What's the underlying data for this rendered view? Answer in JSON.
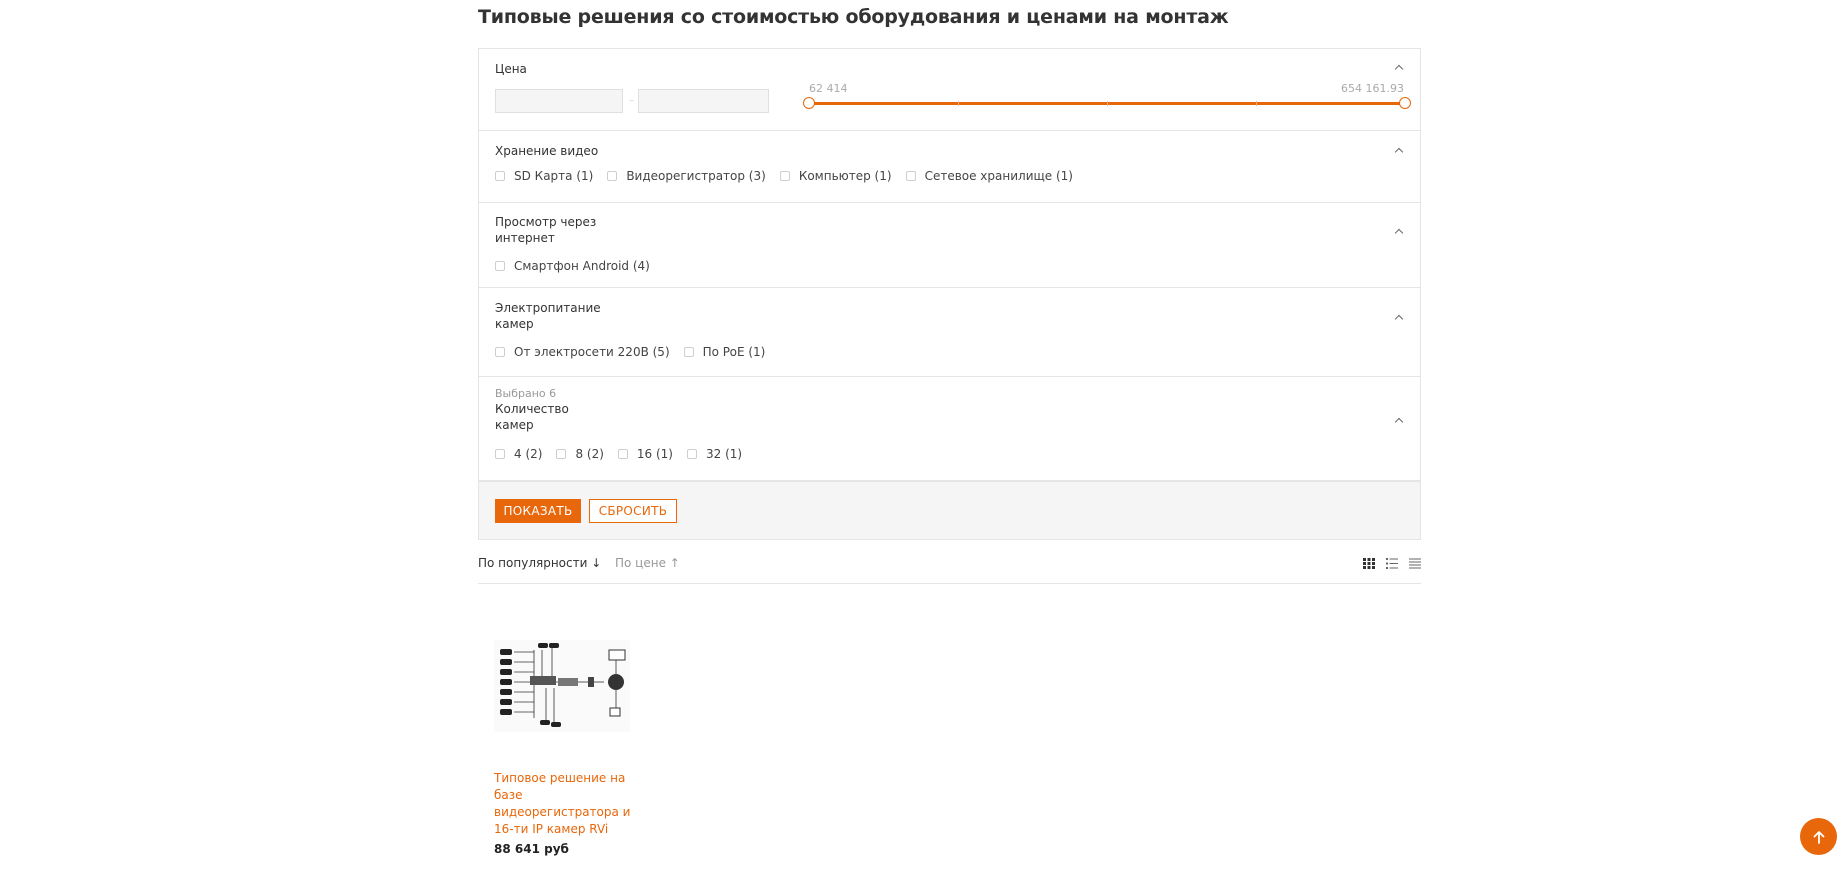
{
  "page": {
    "title": "Типовые решения со стоимостью оборудования и ценами на монтаж"
  },
  "filters": {
    "price": {
      "title": "Цена",
      "min_value": "",
      "max_value": "",
      "range_dash": "–",
      "slider_min_label": "62 414",
      "slider_max_label": "654 161.93",
      "selected_min_fraction": 0,
      "selected_max_fraction": 1
    },
    "storage": {
      "title": "Хранение видео",
      "options": [
        "SD Карта (1)",
        "Видеорегистратор (3)",
        "Компьютер (1)",
        "Сетевое хранилище (1)"
      ]
    },
    "internet_view": {
      "title_line1": "Просмотр через",
      "title_line2": "интернет",
      "options": [
        "Смартфон Android (4)"
      ]
    },
    "power": {
      "title_line1": "Электропитание",
      "title_line2": "камер",
      "options": [
        "От электросети 220В (5)",
        "По PoE (1)"
      ]
    },
    "camera_count": {
      "selected_hint": "Выбрано 6",
      "title_line1": "Количество",
      "title_line2": "камер",
      "options": [
        "4 (2)",
        "8 (2)",
        "16 (1)",
        "32 (1)"
      ]
    },
    "actions": {
      "show_label": "ПОКАЗАТЬ",
      "reset_label": "СБРОСИТЬ"
    }
  },
  "sort": {
    "popularity_label": "По популярности ↓",
    "price_label": "По цене ↑",
    "views": [
      "grid-view-icon",
      "list-view-icon",
      "table-view-icon"
    ]
  },
  "products": [
    {
      "title": "Типовое решение на базе видеорегистратора и 16-ти IP камер RVi",
      "price": "88 641 руб"
    }
  ],
  "colors": {
    "accent": "#e8670a",
    "border": "#e5e5e5",
    "panel_bg": "#f5f5f5"
  }
}
